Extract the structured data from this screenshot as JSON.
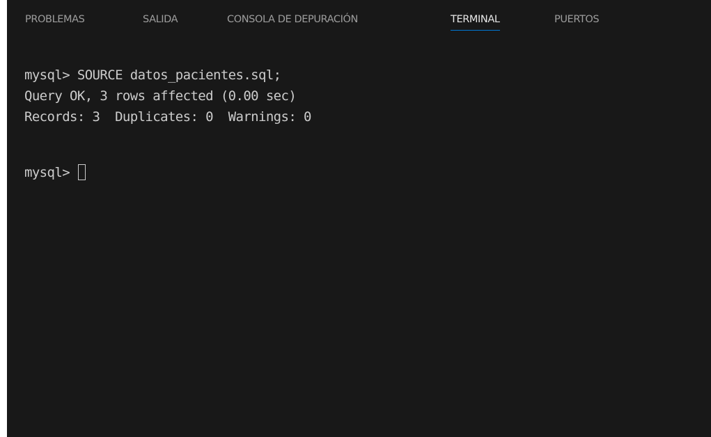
{
  "tabs": [
    {
      "label": "PROBLEMAS",
      "active": false
    },
    {
      "label": "SALIDA",
      "active": false
    },
    {
      "label": "CONSOLA DE DEPURACIÓN",
      "active": false
    },
    {
      "label": "TERMINAL",
      "active": true
    },
    {
      "label": "PUERTOS",
      "active": false
    }
  ],
  "terminal": {
    "lines": [
      "mysql> SOURCE datos_pacientes.sql;",
      "Query OK, 3 rows affected (0.00 sec)",
      "Records: 3  Duplicates: 0  Warnings: 0",
      ""
    ],
    "prompt": "mysql> "
  },
  "colors": {
    "background": "#181818",
    "text": "#cccccc",
    "tab_inactive": "#9d9d9d",
    "tab_active": "#e7e7e7",
    "tab_underline": "#0078d4"
  }
}
